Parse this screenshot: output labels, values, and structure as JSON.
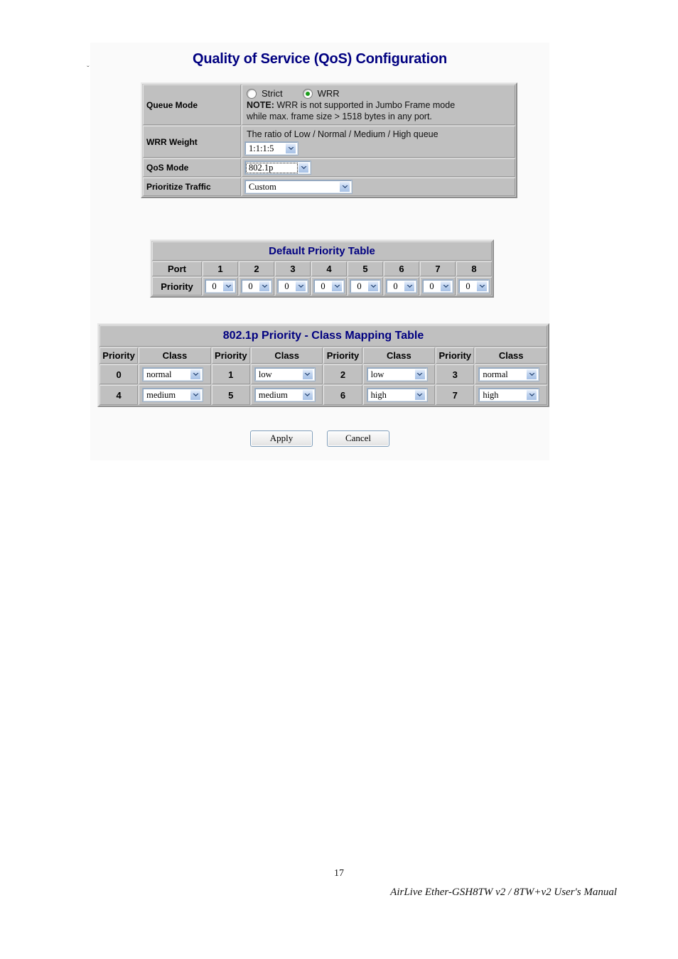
{
  "page": {
    "title": "Quality of Service (QoS) Configuration",
    "page_number": "17",
    "footer": "AirLive Ether-GSH8TW v2 / 8TW+v2 User's Manual",
    "title_color": "#000080",
    "scan_mark": "ˇ"
  },
  "config": {
    "queue_mode": {
      "label": "Queue Mode",
      "options": [
        {
          "label": "Strict",
          "selected": false
        },
        {
          "label": "WRR",
          "selected": true
        }
      ],
      "note_prefix": "NOTE:",
      "note_line1": " WRR is not supported in Jumbo Frame mode",
      "note_line2": "while max. frame size > 1518 bytes in any port."
    },
    "wrr_weight": {
      "label": "WRR Weight",
      "description": "The ratio of Low / Normal / Medium / High queue",
      "value": "1:1:1:5"
    },
    "qos_mode": {
      "label": "QoS Mode",
      "value": "802.1p",
      "focused": true
    },
    "prioritize_traffic": {
      "label": "Prioritize Traffic",
      "value": "Custom"
    }
  },
  "default_priority_table": {
    "caption": "Default Priority Table",
    "row_headers": [
      "Port",
      "Priority"
    ],
    "ports": [
      "1",
      "2",
      "3",
      "4",
      "5",
      "6",
      "7",
      "8"
    ],
    "priorities": [
      "0",
      "0",
      "0",
      "0",
      "0",
      "0",
      "0",
      "0"
    ]
  },
  "mapping_table": {
    "caption": "802.1p Priority - Class Mapping Table",
    "headers": [
      "Priority",
      "Class",
      "Priority",
      "Class",
      "Priority",
      "Class",
      "Priority",
      "Class"
    ],
    "rows": [
      [
        {
          "priority": "0",
          "class": "normal"
        },
        {
          "priority": "1",
          "class": "low"
        },
        {
          "priority": "2",
          "class": "low"
        },
        {
          "priority": "3",
          "class": "normal"
        }
      ],
      [
        {
          "priority": "4",
          "class": "medium"
        },
        {
          "priority": "5",
          "class": "medium"
        },
        {
          "priority": "6",
          "class": "high"
        },
        {
          "priority": "7",
          "class": "high"
        }
      ]
    ]
  },
  "buttons": {
    "apply": "Apply",
    "cancel": "Cancel"
  }
}
